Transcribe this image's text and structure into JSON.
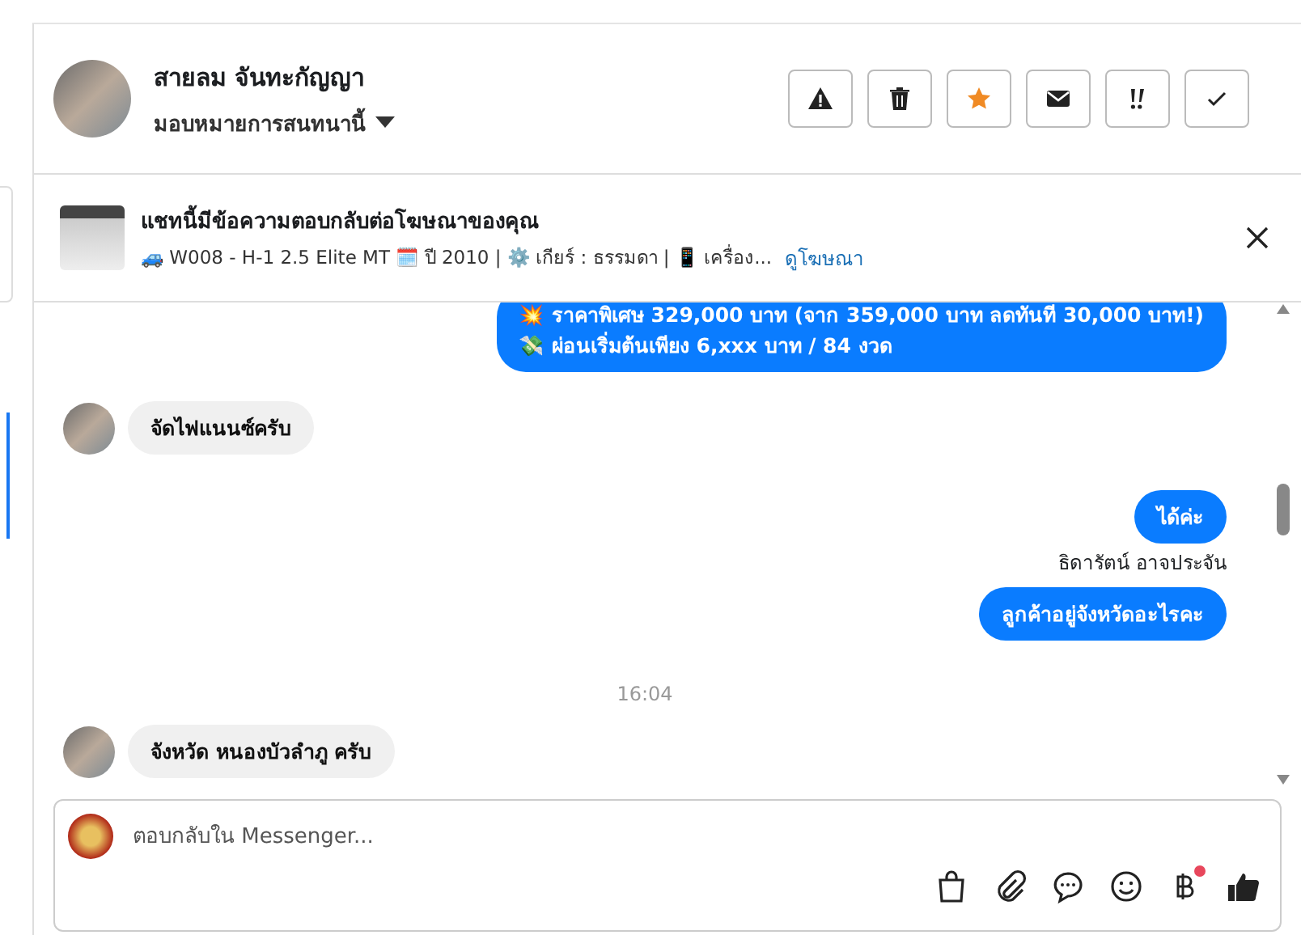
{
  "header": {
    "name": "สายลม จันทะกัญญา",
    "assign": "มอบหมายการสนทนานี้",
    "actions": [
      {
        "kind": "warning",
        "selected": false
      },
      {
        "kind": "trash",
        "selected": false
      },
      {
        "kind": "star",
        "selected": true
      },
      {
        "kind": "mail",
        "selected": false
      },
      {
        "kind": "urgent",
        "selected": false
      },
      {
        "kind": "check",
        "selected": false
      }
    ]
  },
  "ad": {
    "title": "แชทนี้มีข้อความตอบกลับต่อโฆษณาของคุณ",
    "details": "🚙 W008 - H-1 2.5 Elite MT 🗓️ ปี 2010 | ⚙️ เกียร์ : ธรรมดา | 📱 เครื่อง...",
    "link": "ดูโฆษณา"
  },
  "messages": [
    {
      "kind": "outgoing",
      "lines": [
        "💥 ราคาพิเศษ 329,000 บาท (จาก 359,000 บาท ลดทันที 30,000 บาท!)",
        "💸 ผ่อนเริ่มต้นเพียง 6,xxx บาท / 84 งวด"
      ]
    },
    {
      "kind": "incoming",
      "lines": [
        "จัดไฟแนนซ์ครับ"
      ]
    },
    {
      "kind": "outgoing",
      "lines": [
        "ได้ค่ะ"
      ]
    },
    {
      "kind": "sender",
      "text": "ธิดารัตน์ อาจประจัน"
    },
    {
      "kind": "outgoing",
      "lines": [
        "ลูกค้าอยู่จังหวัดอะไรคะ"
      ]
    },
    {
      "kind": "time",
      "text": "16:04"
    },
    {
      "kind": "incoming",
      "lines": [
        "จังหวัด หนองบัวลำภู ครับ"
      ]
    }
  ],
  "composer": {
    "placeholder": "ตอบกลับใน Messenger...",
    "tools": [
      {
        "kind": "bag",
        "badge": false
      },
      {
        "kind": "clip",
        "badge": false
      },
      {
        "kind": "bubble",
        "badge": false
      },
      {
        "kind": "smile",
        "badge": false
      },
      {
        "kind": "baht",
        "badge": true
      },
      {
        "kind": "like",
        "badge": false
      }
    ]
  }
}
